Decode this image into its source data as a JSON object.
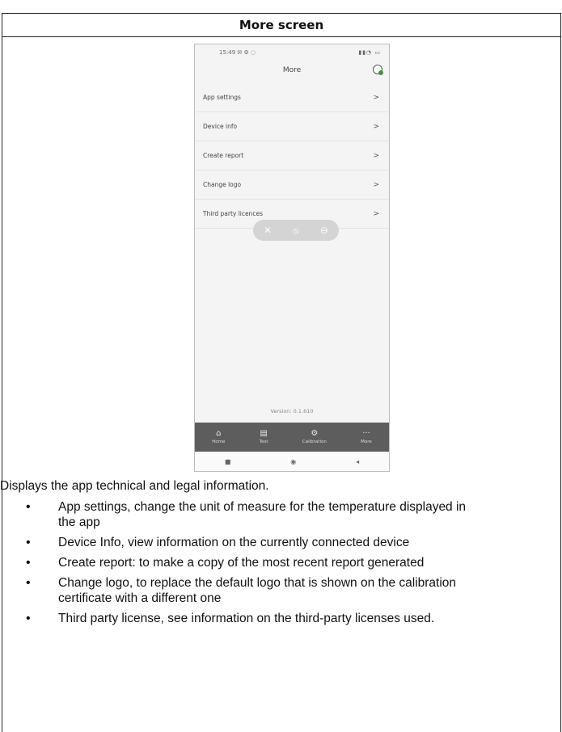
{
  "header": {
    "title": "More screen"
  },
  "phone": {
    "status_time": "15:49 ✉ ⚙ ◌",
    "status_icons": "▮▮◔ ▭",
    "screen_title": "More",
    "menu": [
      {
        "label": "App settings"
      },
      {
        "label": "Device info"
      },
      {
        "label": "Create report"
      },
      {
        "label": "Change logo"
      },
      {
        "label": "Third party licences"
      }
    ],
    "chevron": ">",
    "version": "Version: 0.1.610",
    "bottom_nav": [
      {
        "label": "Home",
        "icon": "home-icon",
        "glyph": "⌂"
      },
      {
        "label": "Test",
        "icon": "document-icon",
        "glyph": "▤"
      },
      {
        "label": "Calibration",
        "icon": "gear-icon",
        "glyph": "⚙"
      },
      {
        "label": "More",
        "icon": "more-icon",
        "glyph": "···"
      }
    ],
    "system_nav": [
      "■",
      "◉",
      "◂"
    ]
  },
  "description": {
    "intro": "Displays the app technical and legal information.",
    "bullets": [
      "App settings, change the unit of measure for the temperature displayed in the app",
      "Device Info, view information on the currently connected device",
      "Create report: to make a copy of the most recent report generated",
      "Change logo, to replace the default logo that is shown on the calibration certificate with a different one",
      "Third party license, see information on the third-party licenses used."
    ]
  }
}
